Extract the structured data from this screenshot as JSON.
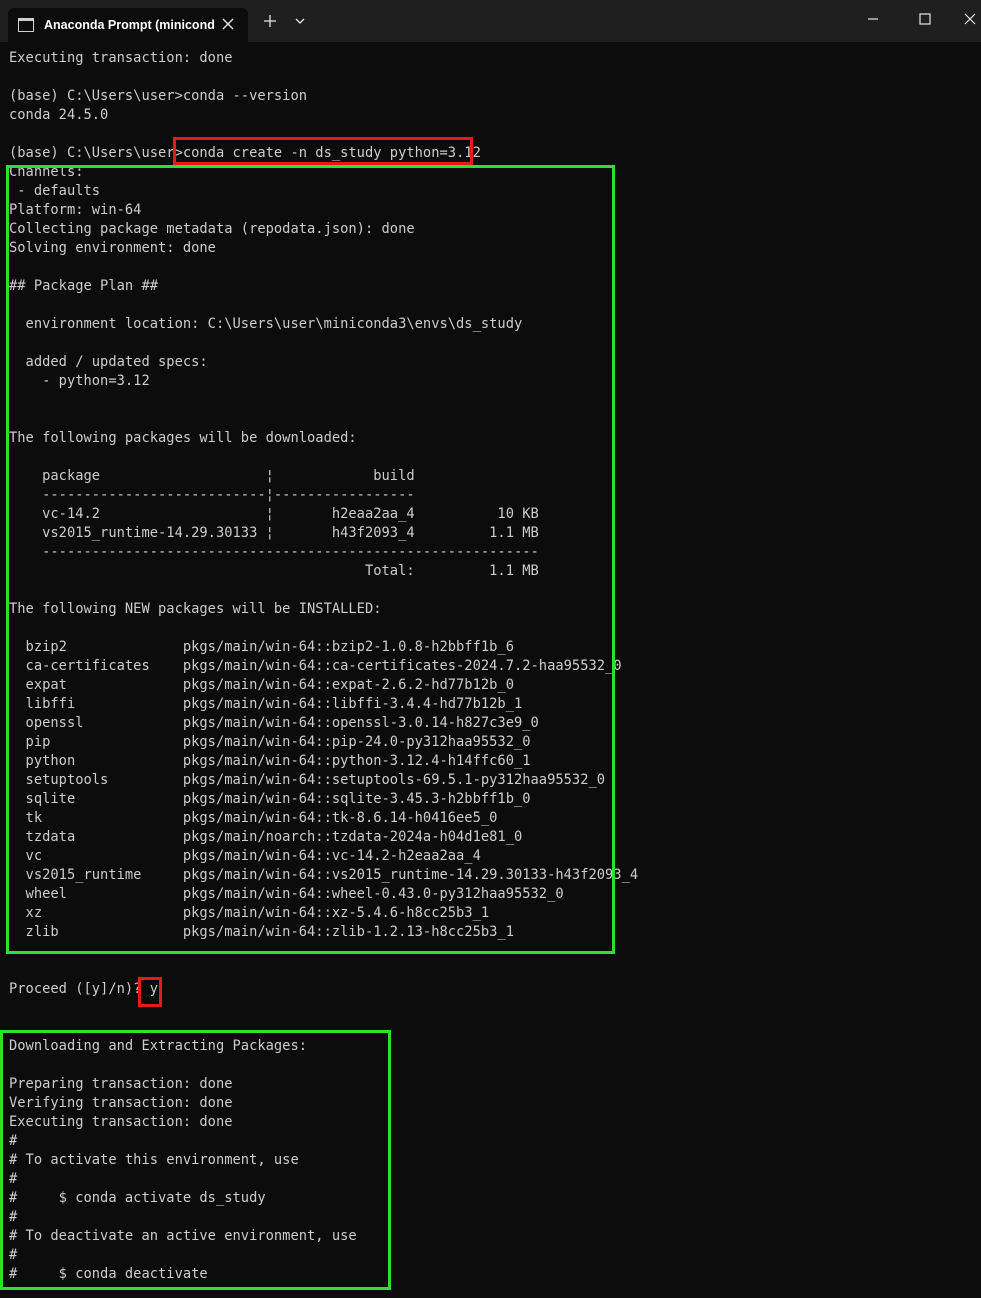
{
  "window": {
    "tab_title": "Anaconda Prompt (miniconda",
    "accent_red": "#e21b1b",
    "accent_green": "#2ee02e",
    "icons": [
      "terminal-icon",
      "close-icon",
      "plus-icon",
      "chevron-down-icon",
      "minimize-icon",
      "maximize-icon",
      "close-window-icon"
    ]
  },
  "terminal": {
    "lines": [
      "Executing transaction: done",
      "",
      "(base) C:\\Users\\user>conda --version",
      "conda 24.5.0",
      "",
      "(base) C:\\Users\\user>conda create -n ds_study python=3.12",
      "Channels:",
      " - defaults",
      "Platform: win-64",
      "Collecting package metadata (repodata.json): done",
      "Solving environment: done",
      "",
      "## Package Plan ##",
      "",
      "  environment location: C:\\Users\\user\\miniconda3\\envs\\ds_study",
      "",
      "  added / updated specs:",
      "    - python=3.12",
      "",
      "",
      "The following packages will be downloaded:",
      "",
      "    package                    ¦            build",
      "    ---------------------------¦-----------------",
      "    vc-14.2                    ¦       h2eaa2aa_4          10 KB",
      "    vs2015_runtime-14.29.30133 ¦       h43f2093_4         1.1 MB",
      "    ------------------------------------------------------------",
      "                                           Total:         1.1 MB",
      "",
      "The following NEW packages will be INSTALLED:",
      "",
      "  bzip2              pkgs/main/win-64::bzip2-1.0.8-h2bbff1b_6",
      "  ca-certificates    pkgs/main/win-64::ca-certificates-2024.7.2-haa95532_0",
      "  expat              pkgs/main/win-64::expat-2.6.2-hd77b12b_0",
      "  libffi             pkgs/main/win-64::libffi-3.4.4-hd77b12b_1",
      "  openssl            pkgs/main/win-64::openssl-3.0.14-h827c3e9_0",
      "  pip                pkgs/main/win-64::pip-24.0-py312haa95532_0",
      "  python             pkgs/main/win-64::python-3.12.4-h14ffc60_1",
      "  setuptools         pkgs/main/win-64::setuptools-69.5.1-py312haa95532_0",
      "  sqlite             pkgs/main/win-64::sqlite-3.45.3-h2bbff1b_0",
      "  tk                 pkgs/main/win-64::tk-8.6.14-h0416ee5_0",
      "  tzdata             pkgs/main/noarch::tzdata-2024a-h04d1e81_0",
      "  vc                 pkgs/main/win-64::vc-14.2-h2eaa2aa_4",
      "  vs2015_runtime     pkgs/main/win-64::vs2015_runtime-14.29.30133-h43f2093_4",
      "  wheel              pkgs/main/win-64::wheel-0.43.0-py312haa95532_0",
      "  xz                 pkgs/main/win-64::xz-5.4.6-h8cc25b3_1",
      "  zlib               pkgs/main/win-64::zlib-1.2.13-h8cc25b3_1",
      "",
      "",
      "Proceed ([y]/n)? y",
      "",
      "",
      "Downloading and Extracting Packages:",
      "",
      "Preparing transaction: done",
      "Verifying transaction: done",
      "Executing transaction: done",
      "#",
      "# To activate this environment, use",
      "#",
      "#     $ conda activate ds_study",
      "#",
      "# To deactivate an active environment, use",
      "#",
      "#     $ conda deactivate"
    ]
  }
}
